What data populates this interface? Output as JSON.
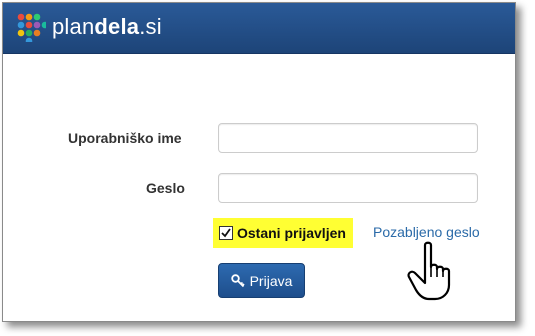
{
  "brand": {
    "name_plain": "plan",
    "name_bold": "dela",
    "name_suffix": ".si"
  },
  "form": {
    "username_label": "Uporabniško ime",
    "username_value": "",
    "password_label": "Geslo",
    "password_value": "",
    "remember_label": "Ostani prijavljen",
    "remember_checked": true,
    "forgot_label": "Pozabljeno geslo",
    "submit_label": "Prijava"
  },
  "icons": {
    "logo": "plandela-dots-logo",
    "submit": "key-icon",
    "cursor": "hand-pointer-icon"
  },
  "colors": {
    "navbar": "#1d4478",
    "highlight": "#ffff33",
    "link": "#2a6aa8",
    "button": "#1e4e8c"
  }
}
